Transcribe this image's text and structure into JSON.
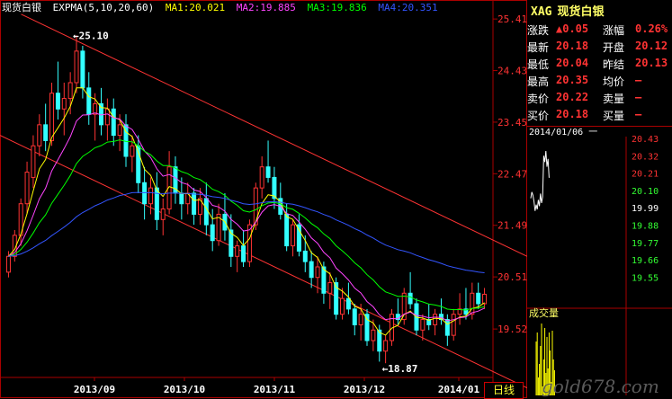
{
  "legend": {
    "name": "现货白银",
    "indicator": "EXPMA(5,10,20,60)",
    "ma1": "MA1:20.021",
    "ma2": "MA2:19.885",
    "ma3": "MA3:19.836",
    "ma4": "MA4:20.351",
    "colors": {
      "name": "#ffffff",
      "indicator": "#ffffff",
      "ma1": "#ffff00",
      "ma2": "#ff44ff",
      "ma3": "#00ff00",
      "ma4": "#3355ff"
    }
  },
  "annotations": {
    "high": "25.10",
    "low": "18.87"
  },
  "timeframe_button": "日线",
  "watermark": "gold678.com",
  "quote": {
    "symbol": "XAG",
    "name": "现货白银",
    "rows": [
      {
        "l1": "涨跌",
        "v1": "▲0.05",
        "l2": "涨幅",
        "v2": "0.26%"
      },
      {
        "l1": "最新",
        "v1": "20.18",
        "l2": "开盘",
        "v2": "20.12"
      },
      {
        "l1": "最低",
        "v1": "20.04",
        "l2": "昨结",
        "v2": "20.13"
      },
      {
        "l1": "最高",
        "v1": "20.35",
        "l2": "均价",
        "v2": "—"
      },
      {
        "l1": "卖价",
        "v1": "20.22",
        "l2": "卖量",
        "v2": "—"
      },
      {
        "l1": "买价",
        "v1": "20.18",
        "l2": "买量",
        "v2": "—"
      }
    ]
  },
  "intraday": {
    "date": "2014/01/06 一",
    "ticks": [
      "20.43",
      "20.32",
      "20.21",
      "20.10",
      "19.99",
      "19.88",
      "19.77",
      "19.66",
      "19.55"
    ],
    "volume_label": "成交量"
  },
  "chart_data": {
    "type": "candlestick",
    "y_ticks": [
      "25.41",
      "24.43",
      "23.45",
      "22.47",
      "21.49",
      "20.51",
      "19.52"
    ],
    "x_ticks": [
      "2013/09",
      "2013/10",
      "2013/11",
      "2013/12",
      "2014/01"
    ],
    "ylim": [
      18.6,
      25.6
    ],
    "ohlc": [
      [
        20.6,
        21.0,
        20.5,
        20.9
      ],
      [
        20.9,
        21.4,
        20.8,
        21.3
      ],
      [
        21.3,
        22.0,
        21.1,
        21.9
      ],
      [
        21.9,
        22.7,
        21.7,
        22.5
      ],
      [
        22.4,
        23.2,
        22.2,
        23.0
      ],
      [
        23.0,
        23.6,
        22.8,
        23.4
      ],
      [
        23.4,
        23.8,
        22.9,
        23.1
      ],
      [
        23.1,
        24.2,
        23.0,
        24.0
      ],
      [
        24.0,
        24.6,
        23.5,
        23.7
      ],
      [
        23.7,
        24.2,
        23.2,
        23.9
      ],
      [
        23.9,
        24.4,
        23.6,
        24.2
      ],
      [
        24.2,
        25.1,
        24.0,
        24.8
      ],
      [
        24.8,
        24.9,
        23.9,
        24.1
      ],
      [
        24.1,
        24.4,
        23.4,
        23.6
      ],
      [
        23.6,
        24.0,
        23.1,
        23.8
      ],
      [
        23.8,
        24.1,
        23.2,
        23.4
      ],
      [
        23.4,
        23.9,
        23.1,
        23.7
      ],
      [
        23.7,
        23.9,
        23.0,
        23.2
      ],
      [
        23.2,
        23.6,
        22.9,
        23.4
      ],
      [
        23.4,
        23.6,
        22.6,
        22.8
      ],
      [
        22.8,
        23.2,
        22.5,
        23.0
      ],
      [
        23.0,
        23.2,
        22.1,
        22.3
      ],
      [
        22.3,
        22.6,
        21.6,
        21.9
      ],
      [
        21.9,
        22.4,
        21.7,
        22.2
      ],
      [
        22.2,
        22.5,
        21.4,
        21.6
      ],
      [
        21.6,
        22.0,
        21.3,
        21.8
      ],
      [
        21.8,
        22.9,
        21.7,
        22.6
      ],
      [
        22.6,
        22.8,
        21.9,
        22.1
      ],
      [
        22.1,
        22.4,
        21.6,
        21.9
      ],
      [
        21.9,
        22.3,
        21.7,
        22.1
      ],
      [
        22.1,
        22.2,
        21.5,
        21.7
      ],
      [
        21.7,
        22.2,
        21.5,
        22.0
      ],
      [
        22.0,
        22.3,
        21.3,
        21.5
      ],
      [
        21.5,
        21.8,
        21.0,
        21.2
      ],
      [
        21.2,
        21.9,
        21.1,
        21.7
      ],
      [
        21.7,
        22.1,
        21.2,
        21.4
      ],
      [
        21.4,
        21.7,
        20.7,
        20.9
      ],
      [
        20.9,
        21.2,
        20.6,
        21.1
      ],
      [
        21.1,
        21.4,
        20.7,
        20.8
      ],
      [
        20.8,
        21.6,
        20.7,
        21.5
      ],
      [
        21.5,
        22.3,
        21.4,
        22.2
      ],
      [
        22.2,
        22.8,
        22.0,
        22.6
      ],
      [
        22.6,
        23.1,
        22.3,
        22.4
      ],
      [
        22.4,
        22.6,
        21.8,
        22.0
      ],
      [
        22.0,
        22.3,
        21.6,
        21.7
      ],
      [
        21.7,
        21.9,
        21.0,
        21.1
      ],
      [
        21.1,
        21.6,
        20.9,
        21.5
      ],
      [
        21.5,
        21.7,
        20.9,
        21.0
      ],
      [
        21.0,
        21.3,
        20.6,
        20.8
      ],
      [
        20.8,
        21.0,
        20.3,
        20.5
      ],
      [
        20.5,
        20.9,
        20.2,
        20.7
      ],
      [
        20.7,
        20.8,
        20.0,
        20.2
      ],
      [
        20.2,
        20.6,
        19.9,
        20.4
      ],
      [
        20.4,
        20.5,
        19.7,
        19.8
      ],
      [
        19.8,
        20.3,
        19.7,
        20.1
      ],
      [
        20.1,
        20.4,
        19.8,
        19.9
      ],
      [
        19.9,
        20.0,
        19.4,
        19.6
      ],
      [
        19.6,
        20.0,
        19.3,
        19.8
      ],
      [
        19.8,
        19.9,
        19.2,
        19.3
      ],
      [
        19.3,
        19.7,
        19.1,
        19.5
      ],
      [
        19.5,
        19.6,
        18.9,
        19.1
      ],
      [
        19.1,
        19.4,
        18.87,
        19.3
      ],
      [
        19.3,
        19.9,
        19.2,
        19.8
      ],
      [
        19.8,
        20.1,
        19.6,
        19.7
      ],
      [
        19.7,
        20.3,
        19.6,
        20.2
      ],
      [
        20.2,
        20.6,
        19.9,
        20.0
      ],
      [
        20.0,
        20.1,
        19.4,
        19.5
      ],
      [
        19.5,
        19.8,
        19.3,
        19.7
      ],
      [
        19.7,
        20.0,
        19.5,
        19.6
      ],
      [
        19.6,
        19.9,
        19.4,
        19.8
      ],
      [
        19.8,
        20.1,
        19.6,
        19.7
      ],
      [
        19.7,
        19.8,
        19.2,
        19.4
      ],
      [
        19.4,
        19.9,
        19.3,
        19.8
      ],
      [
        19.8,
        20.2,
        19.6,
        19.9
      ],
      [
        19.9,
        20.3,
        19.7,
        19.8
      ],
      [
        19.8,
        20.4,
        19.7,
        20.2
      ],
      [
        20.2,
        20.4,
        19.9,
        20.0
      ],
      [
        20.0,
        20.3,
        19.9,
        20.18
      ]
    ],
    "channel_upper": [
      [
        23.5,
        25.5
      ],
      [
        586,
        20.9
      ]
    ],
    "channel_lower": [
      [
        0,
        23.2
      ],
      [
        586,
        18.4
      ]
    ]
  }
}
